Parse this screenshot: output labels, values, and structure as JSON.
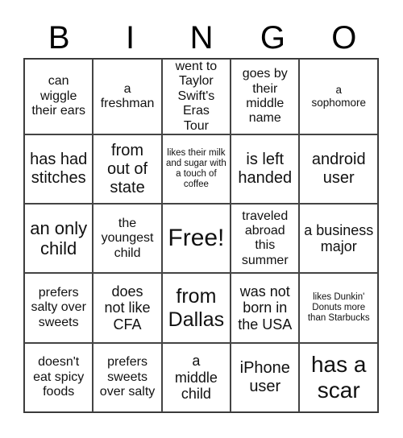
{
  "header": [
    "B",
    "I",
    "N",
    "G",
    "O"
  ],
  "cells": [
    [
      "can wiggle their ears",
      "a freshman",
      "went to Taylor Swift's Eras Tour",
      "goes by their middle name",
      "a sophomore"
    ],
    [
      "has had stitches",
      "from out of state",
      "likes their milk and sugar with a touch of coffee",
      "is left handed",
      "android user"
    ],
    [
      "an only child",
      "the youngest child",
      "Free!",
      "traveled abroad this summer",
      "a business major"
    ],
    [
      "prefers salty over sweets",
      "does not like CFA",
      "from Dallas",
      "was not born in the USA",
      "likes Dunkin' Donuts more than Starbucks"
    ],
    [
      "doesn't eat spicy foods",
      "prefers sweets over salty",
      "a middle child",
      "iPhone user",
      "has a scar"
    ]
  ]
}
